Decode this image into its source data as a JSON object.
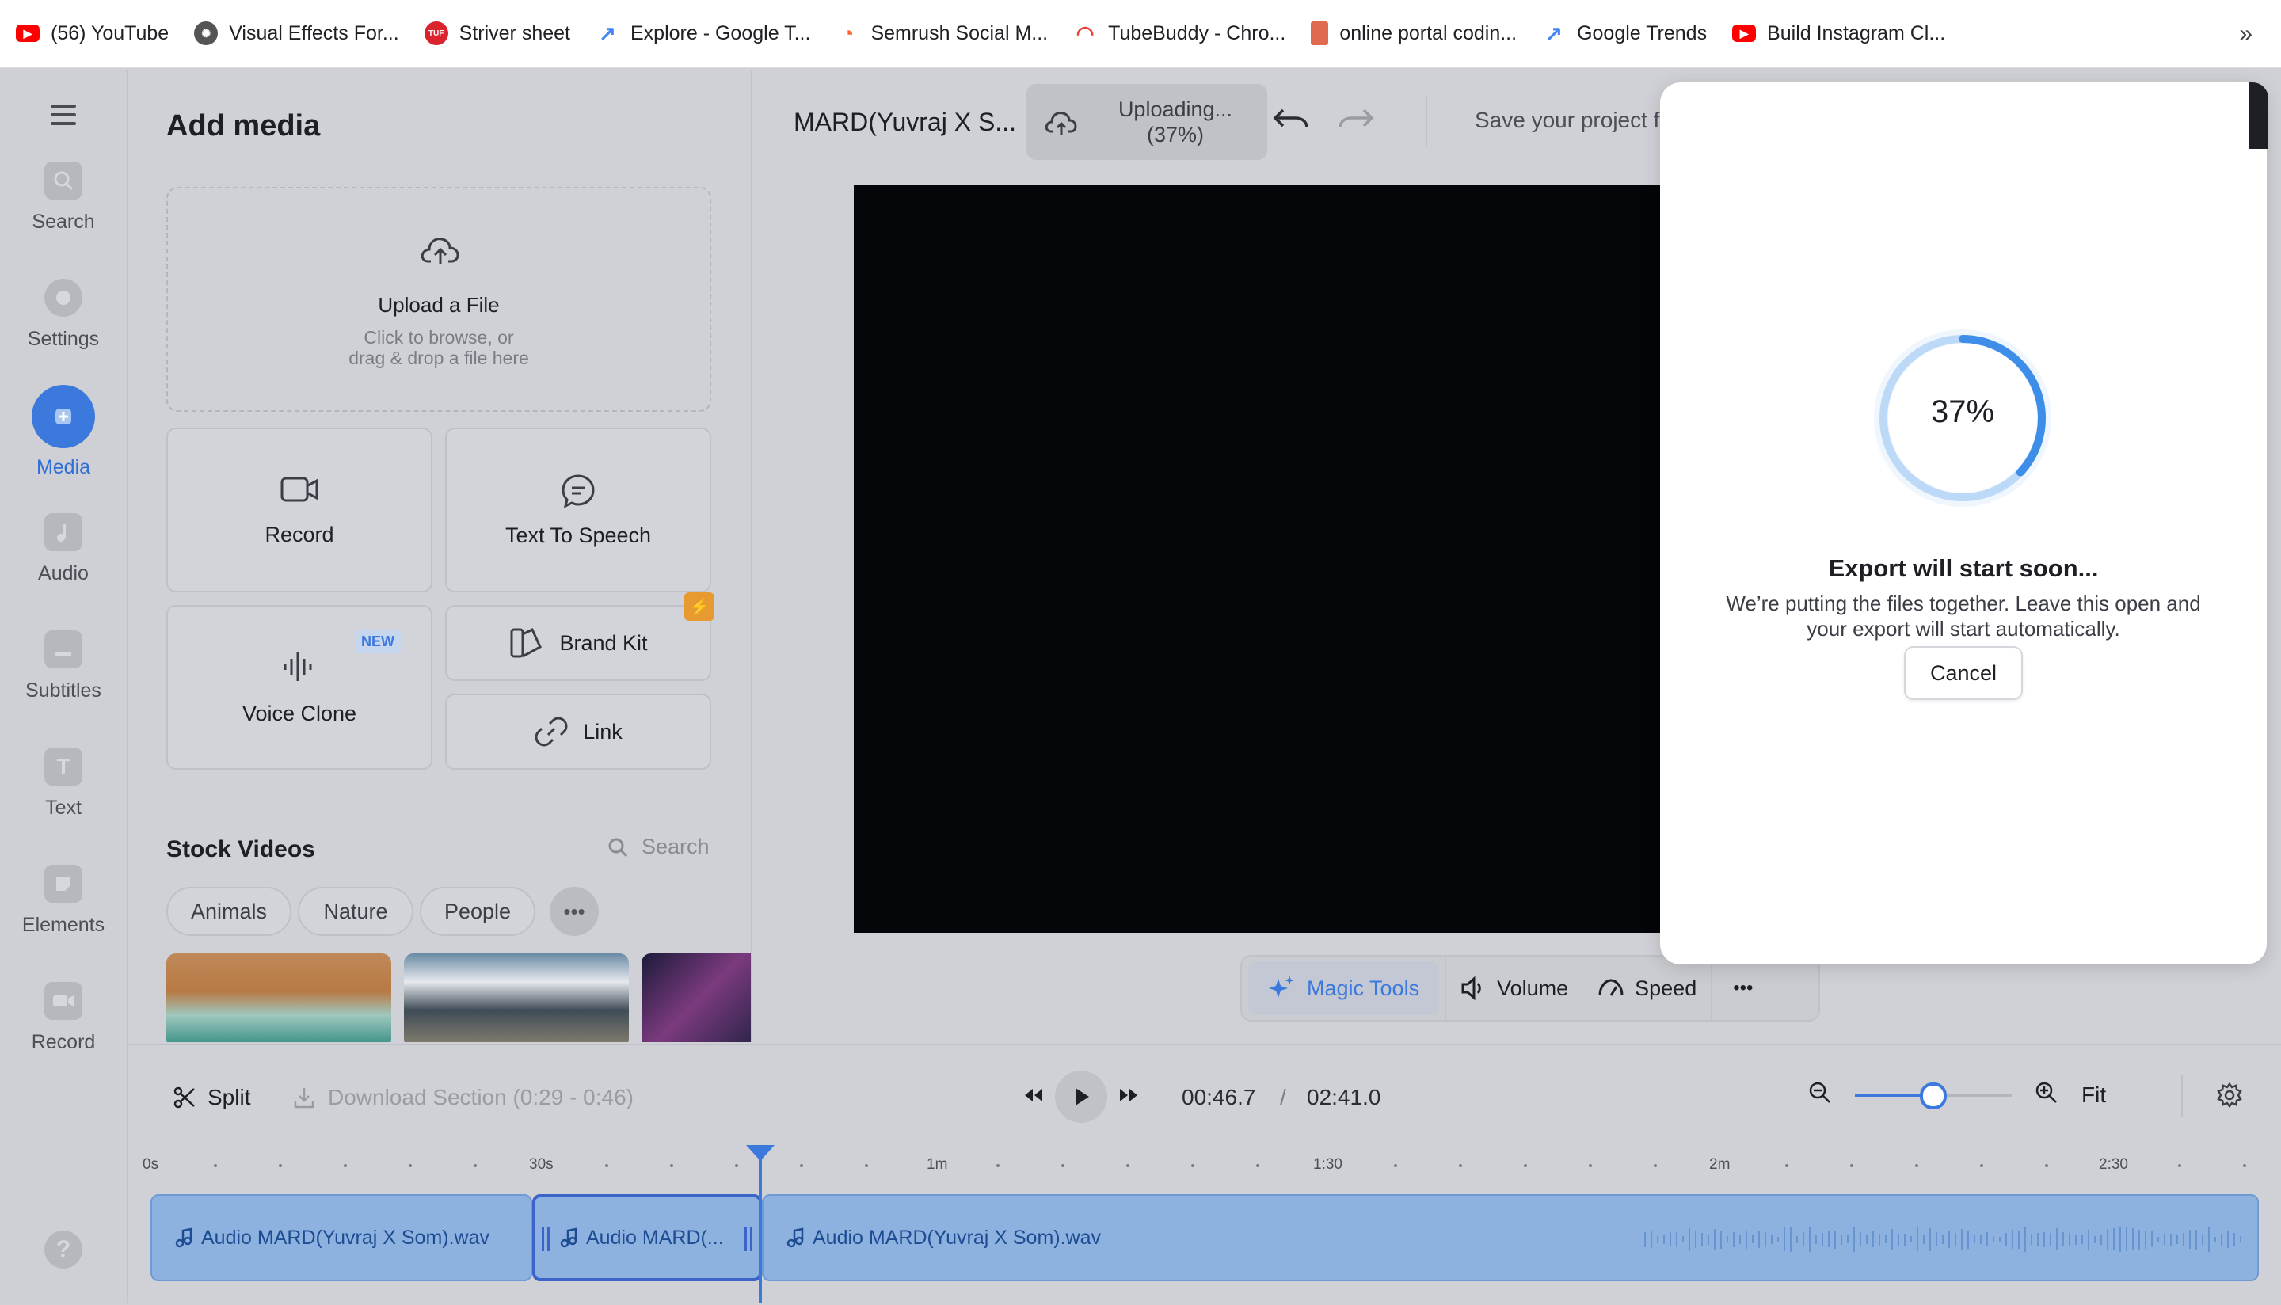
{
  "bookmarks": [
    {
      "label": "(56) YouTube",
      "icon": "youtube-icon",
      "color": "#ff0000"
    },
    {
      "label": "Visual Effects For...",
      "icon": "film-reel-icon",
      "color": "#444444"
    },
    {
      "label": "Striver sheet",
      "icon": "tuf-icon",
      "color": "#d9232d"
    },
    {
      "label": "Explore - Google T...",
      "icon": "trends-icon",
      "color": "#4285f4"
    },
    {
      "label": "Semrush Social M...",
      "icon": "semrush-icon",
      "color": "#ff642d"
    },
    {
      "label": "TubeBuddy - Chro...",
      "icon": "rainbow-icon",
      "color": "#e94235"
    },
    {
      "label": "online portal codin...",
      "icon": "book-icon",
      "color": "#e06a50"
    },
    {
      "label": "Google Trends",
      "icon": "trends-icon",
      "color": "#4285f4"
    },
    {
      "label": "Build Instagram Cl...",
      "icon": "youtube-icon",
      "color": "#ff0000"
    }
  ],
  "rail": {
    "menu_icon": "hamburger-icon",
    "items": [
      {
        "label": "Search",
        "icon": "search-icon"
      },
      {
        "label": "Settings",
        "icon": "settings-icon"
      },
      {
        "label": "Media",
        "icon": "plus-icon",
        "active": true
      },
      {
        "label": "Audio",
        "icon": "music-note-icon"
      },
      {
        "label": "Subtitles",
        "icon": "subtitles-icon"
      },
      {
        "label": "Text",
        "icon": "text-icon"
      },
      {
        "label": "Elements",
        "icon": "elements-icon"
      },
      {
        "label": "Record",
        "icon": "camera-icon"
      }
    ],
    "help": "?"
  },
  "panel": {
    "title": "Add media",
    "upload": {
      "title": "Upload a File",
      "sub1": "Click to browse, or",
      "sub2": "drag & drop a file here"
    },
    "cards": {
      "record": "Record",
      "tts": "Text To Speech",
      "voice_clone": "Voice Clone",
      "new_badge": "NEW",
      "brand_kit": "Brand Kit",
      "link": "Link"
    },
    "stock": {
      "title": "Stock Videos",
      "search_placeholder": "Search",
      "chips": [
        "Animals",
        "Nature",
        "People"
      ]
    }
  },
  "editor": {
    "project_name": "MARD(Yuvraj X S...",
    "upload_status_line1": "Uploading...",
    "upload_status_line2": "(37%)",
    "save_project": "Save your project f",
    "toolbar": {
      "magic": "Magic Tools",
      "volume": "Volume",
      "speed": "Speed"
    }
  },
  "timeline": {
    "split": "Split",
    "download_section": "Download Section (0:29 - 0:46)",
    "current_time": "00:46.7",
    "separator": "/",
    "total_time": "02:41.0",
    "fit": "Fit",
    "zoom_level": 0.5,
    "ruler": [
      "0s",
      "30s",
      "1m",
      "1:30",
      "2m",
      "2:30"
    ],
    "tracks": [
      {
        "label": "Audio MARD(Yuvraj X Som).wav"
      },
      {
        "label": "Audio MARD(..."
      },
      {
        "label": "Audio MARD(Yuvraj X Som).wav"
      }
    ]
  },
  "export": {
    "progress": 37,
    "progress_label": "37%",
    "title": "Export will start soon...",
    "desc_line1": "We’re putting the files together. Leave this open and",
    "desc_line2": "your export will start automatically.",
    "cancel": "Cancel",
    "accent": "#3c8ee8"
  }
}
